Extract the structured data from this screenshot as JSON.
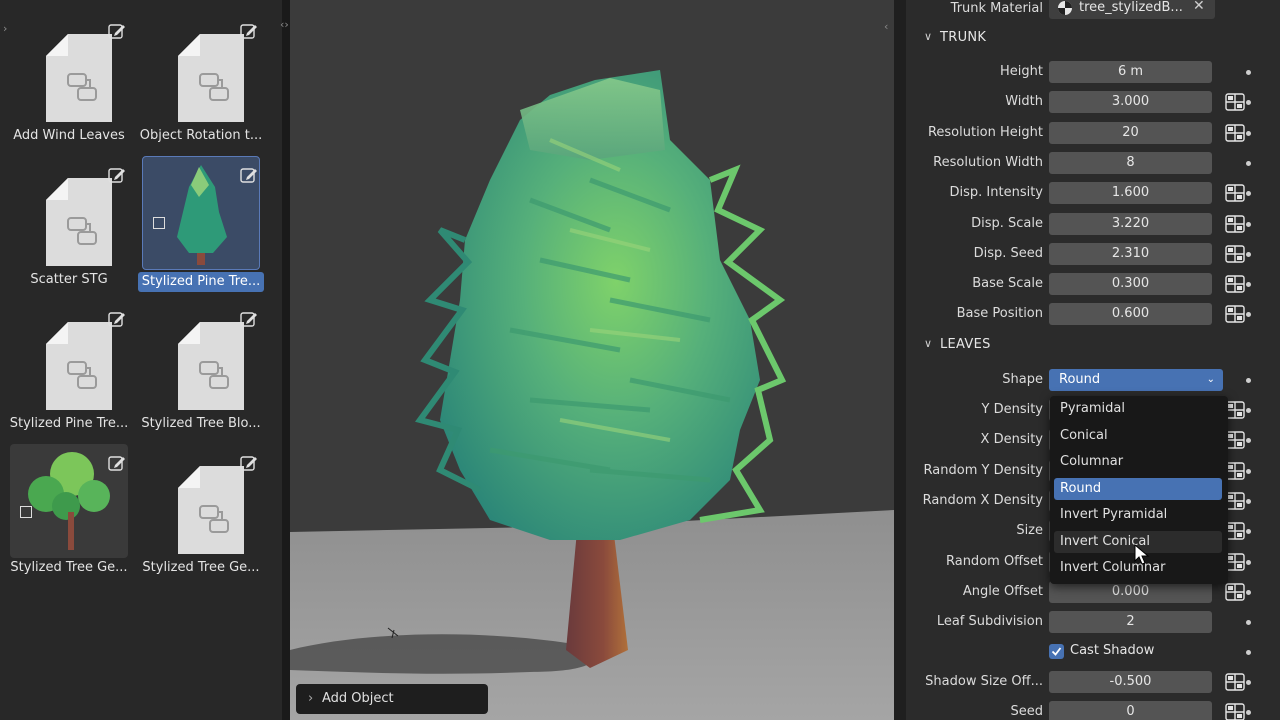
{
  "asset_browser": {
    "assets": [
      {
        "label": "Add Wind Leaves",
        "type": "node-group"
      },
      {
        "label": "Object Rotation t...",
        "type": "node-group"
      },
      {
        "label": "Scatter STG",
        "type": "node-group"
      },
      {
        "label": "Stylized Pine Tre...",
        "type": "preview-pine",
        "selected": true
      },
      {
        "label": "Stylized Pine Tre...",
        "type": "node-group"
      },
      {
        "label": "Stylized Tree Blo...",
        "type": "node-group"
      },
      {
        "label": "Stylized Tree Ge...",
        "type": "preview-tree"
      },
      {
        "label": "Stylized Tree Ge...",
        "type": "node-group"
      }
    ]
  },
  "viewport": {
    "add_object_label": "Add Object"
  },
  "properties": {
    "trunk_material": {
      "label": "Trunk Material",
      "value": "tree_stylizedB..."
    },
    "trunk_section": "TRUNK",
    "trunk_fields": [
      {
        "label": "Height",
        "value": "6 m",
        "keyframe": false
      },
      {
        "label": "Width",
        "value": "3.000",
        "keyframe": true
      },
      {
        "label": "Resolution Height",
        "value": "20",
        "keyframe": true
      },
      {
        "label": "Resolution Width",
        "value": "8",
        "keyframe": false
      },
      {
        "label": "Disp. Intensity",
        "value": "1.600",
        "keyframe": true
      },
      {
        "label": "Disp. Scale",
        "value": "3.220",
        "keyframe": true
      },
      {
        "label": "Disp. Seed",
        "value": "2.310",
        "keyframe": true
      },
      {
        "label": "Base Scale",
        "value": "0.300",
        "keyframe": true
      },
      {
        "label": "Base Position",
        "value": "0.600",
        "keyframe": true
      }
    ],
    "leaves_section": "LEAVES",
    "shape": {
      "label": "Shape",
      "value": "Round"
    },
    "hidden_labels": [
      "Y Density",
      "X Density",
      "Random Y Density",
      "Random X Density",
      "Size",
      "Random Offset"
    ],
    "lower_fields": [
      {
        "label": "Angle Offset",
        "value": "0.000",
        "keyframe": true
      },
      {
        "label": "Leaf Subdivision",
        "value": "2",
        "keyframe": false
      }
    ],
    "cast_shadow": {
      "label": "Cast Shadow",
      "checked": true
    },
    "bottom_fields": [
      {
        "label": "Shadow Size Off...",
        "value": "-0.500",
        "keyframe": true
      },
      {
        "label": "Seed",
        "value": "0",
        "keyframe": true
      }
    ]
  },
  "dropdown": {
    "options": [
      "Pyramidal",
      "Conical",
      "Columnar",
      "Round",
      "Invert Pyramidal",
      "Invert Conical",
      "Invert Columnar"
    ],
    "selected": "Round",
    "hovered": "Invert Conical"
  },
  "colors": {
    "accent": "#4772b3",
    "panel": "#2b2b2b",
    "field": "#545454",
    "viewport": "#3b3b3b"
  }
}
